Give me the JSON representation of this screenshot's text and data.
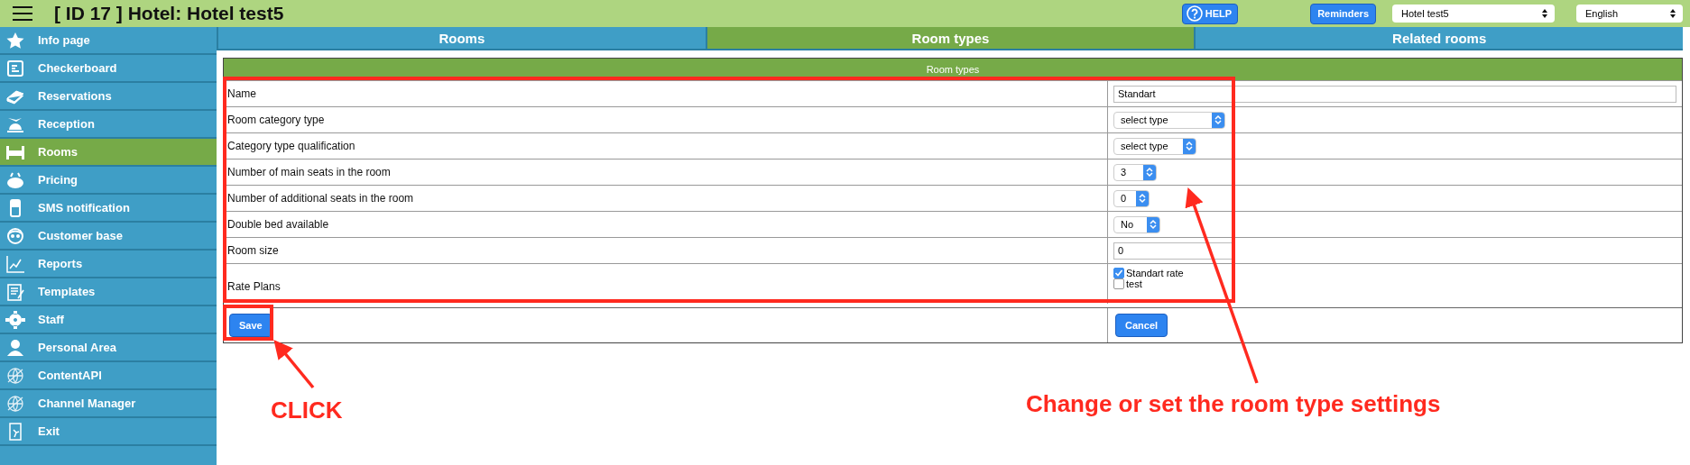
{
  "header": {
    "title": "[ ID 17 ] Hotel: Hotel test5",
    "help": "HELP",
    "reminders": "Reminders",
    "hotel_select": "Hotel test5",
    "language_select": "English"
  },
  "sidebar": {
    "items": [
      {
        "label": "Info page",
        "selected": false
      },
      {
        "label": "Checkerboard",
        "selected": false
      },
      {
        "label": "Reservations",
        "selected": false
      },
      {
        "label": "Reception",
        "selected": false
      },
      {
        "label": "Rooms",
        "selected": true
      },
      {
        "label": "Pricing",
        "selected": false
      },
      {
        "label": "SMS notification",
        "selected": false
      },
      {
        "label": "Customer base",
        "selected": false
      },
      {
        "label": "Reports",
        "selected": false
      },
      {
        "label": "Templates",
        "selected": false
      },
      {
        "label": "Staff",
        "selected": false
      },
      {
        "label": "Personal Area",
        "selected": false
      },
      {
        "label": "ContentAPI",
        "selected": false
      },
      {
        "label": "Channel Manager",
        "selected": false
      },
      {
        "label": "Exit",
        "selected": false
      }
    ]
  },
  "tabs": [
    {
      "label": "Rooms",
      "selected": false
    },
    {
      "label": "Room types",
      "selected": true
    },
    {
      "label": "Related rooms",
      "selected": false
    }
  ],
  "form": {
    "title": "Room types",
    "rows": [
      {
        "label": "Name",
        "kind": "text",
        "value": "Standart"
      },
      {
        "label": "Room category type",
        "kind": "select",
        "value": "select type"
      },
      {
        "label": "Category type qualification",
        "kind": "select",
        "value": "select type"
      },
      {
        "label": "Number of main seats in the room",
        "kind": "select",
        "value": "3"
      },
      {
        "label": "Number of additional seats in the room",
        "kind": "select",
        "value": "0"
      },
      {
        "label": "Double bed available",
        "kind": "select",
        "value": "No"
      },
      {
        "label": "Room size",
        "kind": "text",
        "value": "0"
      },
      {
        "label": "Rate Plans",
        "kind": "checkboxes",
        "options": [
          {
            "label": "Standart rate",
            "checked": true
          },
          {
            "label": "test",
            "checked": false
          }
        ]
      }
    ],
    "save": "Save",
    "cancel": "Cancel"
  },
  "annotations": [
    {
      "text": "CLICK"
    },
    {
      "text": "Change or set the room type settings"
    }
  ]
}
